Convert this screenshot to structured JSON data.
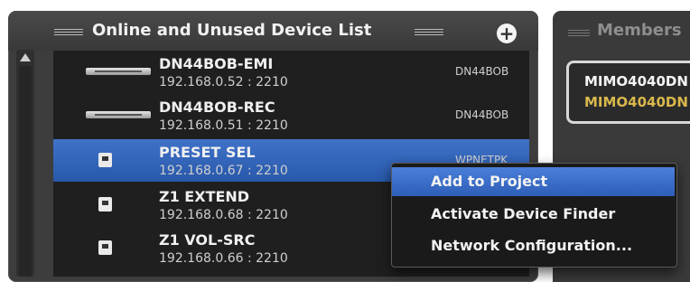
{
  "device_list": {
    "title": "Online and Unused Device List",
    "add_button": "+",
    "devices": [
      {
        "name": "DN44BOB-EMI",
        "ip": "192.168.0.52 : 2210",
        "model": "DN44BOB",
        "icon": "rack-unit-icon"
      },
      {
        "name": "DN44BOB-REC",
        "ip": "192.168.0.51 : 2210",
        "model": "DN44BOB",
        "icon": "rack-unit-icon"
      },
      {
        "name": "PRESET SEL",
        "ip": "192.168.0.67 : 2210",
        "model": "WPNETPK",
        "icon": "wall-panel-icon",
        "selected": true
      },
      {
        "name": "Z1 EXTEND",
        "ip": "192.168.0.68 : 2210",
        "model": "",
        "icon": "wall-panel-icon"
      },
      {
        "name": "Z1 VOL-SRC",
        "ip": "192.168.0.66 : 2210",
        "model": "",
        "icon": "wall-panel-icon"
      }
    ]
  },
  "members": {
    "title": "Members",
    "device_line1": "MIMO4040DN",
    "device_line2": "MIMO4040DN"
  },
  "context_menu": {
    "items": [
      {
        "label": "Add to Project",
        "highlighted": true
      },
      {
        "label": "Activate Device Finder"
      },
      {
        "label": "Network Configuration..."
      }
    ]
  },
  "colors": {
    "selection": "#2f61b4",
    "menu_highlight": "#3a6fcc",
    "members_accent": "#d9b84c"
  }
}
